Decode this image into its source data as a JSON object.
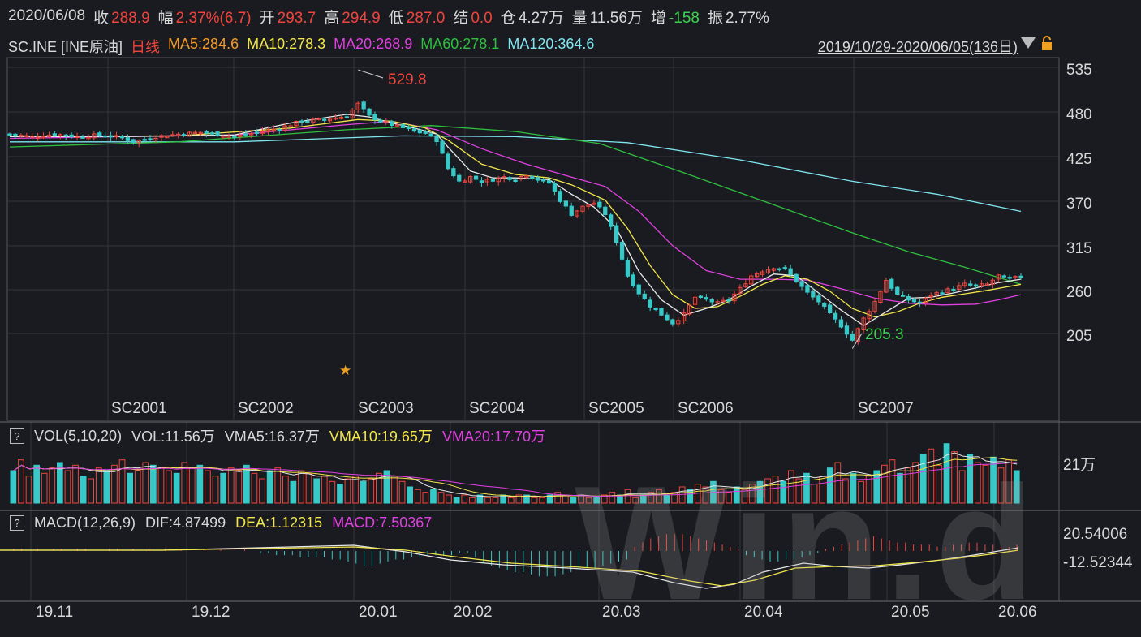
{
  "quote": {
    "date": "2020/06/08",
    "close_label": "收",
    "close": "288.9",
    "change_label": "幅",
    "change": "2.37%(6.7)",
    "open_label": "开",
    "open": "293.7",
    "high_label": "高",
    "high": "294.9",
    "low_label": "低",
    "low": "287.0",
    "settle_label": "结",
    "settle": "0.0",
    "oi_label": "仓",
    "oi": "4.27万",
    "volume_label": "量",
    "volume": "11.56万",
    "oi_change_label": "增",
    "oi_change": "-158",
    "amplitude_label": "振",
    "amplitude": "2.77%"
  },
  "legend": {
    "symbol": "SC.INE [INE原油]",
    "period": "日线",
    "ma5": "MA5:284.6",
    "ma10": "MA10:278.3",
    "ma20": "MA20:268.9",
    "ma60": "MA60:278.1",
    "ma120": "MA120:364.6",
    "range": "2019/10/29-2020/06/05(136日)"
  },
  "colors": {
    "up": "#f0453c",
    "down": "#37c8c8",
    "ma5": "#e8e8e8",
    "ma10": "#f2e64a",
    "ma20": "#e040e0",
    "ma60": "#2fbf3f",
    "ma120": "#7fe6f0"
  },
  "price_axis": {
    "ticks": [
      "535",
      "480",
      "425",
      "370",
      "315",
      "260",
      "205"
    ]
  },
  "annotations": {
    "high": "529.8",
    "low": "205.3"
  },
  "contracts": [
    "SC2001",
    "SC2002",
    "SC2003",
    "SC2004",
    "SC2005",
    "SC2006",
    "SC2007"
  ],
  "volume_panel": {
    "label": "VOL(5,10,20)",
    "vol": "VOL:11.56万",
    "vma5": "VMA5:16.37万",
    "vma10": "VMA10:19.65万",
    "vma20": "VMA20:17.70万",
    "axis": "21万"
  },
  "macd_panel": {
    "label": "MACD(12,26,9)",
    "dif": "DIF:4.87499",
    "dea": "DEA:1.12315",
    "macd": "MACD:7.50367",
    "axis_top": "20.54006",
    "axis_bottom": "-12.52344"
  },
  "date_axis": [
    "19.11",
    "19.12",
    "20.01",
    "20.02",
    "20.03",
    "20.04",
    "20.05",
    "20.06"
  ],
  "watermark": "Win.d",
  "chart_data": {
    "type": "candlestick",
    "ylim": [
      150,
      545
    ],
    "x_range": [
      "2019/10/29",
      "2020/06/05"
    ],
    "close_path": [
      [
        0,
        455
      ],
      [
        4,
        452
      ],
      [
        8,
        455
      ],
      [
        12,
        452
      ],
      [
        16,
        454
      ],
      [
        20,
        451
      ],
      [
        22,
        446
      ],
      [
        26,
        452
      ],
      [
        30,
        455
      ],
      [
        34,
        457
      ],
      [
        38,
        454
      ],
      [
        40,
        452
      ],
      [
        44,
        457
      ],
      [
        48,
        462
      ],
      [
        52,
        470
      ],
      [
        56,
        472
      ],
      [
        60,
        476
      ],
      [
        62,
        490
      ],
      [
        64,
        476
      ],
      [
        66,
        470
      ],
      [
        68,
        466
      ],
      [
        70,
        462
      ],
      [
        72,
        458
      ],
      [
        74,
        456
      ],
      [
        76,
        448
      ],
      [
        78,
        415
      ],
      [
        80,
        400
      ],
      [
        82,
        405
      ],
      [
        84,
        400
      ],
      [
        86,
        402
      ],
      [
        88,
        405
      ],
      [
        90,
        403
      ],
      [
        92,
        408
      ],
      [
        94,
        402
      ],
      [
        96,
        398
      ],
      [
        98,
        378
      ],
      [
        100,
        362
      ],
      [
        102,
        370
      ],
      [
        104,
        375
      ],
      [
        106,
        362
      ],
      [
        108,
        330
      ],
      [
        110,
        290
      ],
      [
        112,
        270
      ],
      [
        114,
        255
      ],
      [
        116,
        245
      ],
      [
        118,
        235
      ],
      [
        120,
        245
      ],
      [
        122,
        265
      ],
      [
        124,
        262
      ],
      [
        126,
        258
      ],
      [
        128,
        262
      ],
      [
        130,
        275
      ],
      [
        132,
        290
      ],
      [
        134,
        296
      ],
      [
        136,
        300
      ],
      [
        138,
        298
      ],
      [
        140,
        284
      ],
      [
        142,
        270
      ],
      [
        144,
        260
      ],
      [
        146,
        245
      ],
      [
        148,
        232
      ],
      [
        150,
        215
      ],
      [
        152,
        240
      ],
      [
        154,
        260
      ],
      [
        156,
        285
      ],
      [
        158,
        268
      ],
      [
        160,
        262
      ],
      [
        162,
        258
      ],
      [
        164,
        268
      ],
      [
        166,
        272
      ],
      [
        168,
        275
      ],
      [
        170,
        280
      ],
      [
        172,
        278
      ],
      [
        174,
        280
      ],
      [
        176,
        290
      ],
      [
        178,
        286
      ],
      [
        180,
        289
      ]
    ],
    "ma5_path": [
      [
        0,
        452
      ],
      [
        20,
        452
      ],
      [
        40,
        454
      ],
      [
        50,
        468
      ],
      [
        60,
        478
      ],
      [
        64,
        475
      ],
      [
        68,
        468
      ],
      [
        72,
        462
      ],
      [
        76,
        455
      ],
      [
        78,
        440
      ],
      [
        82,
        412
      ],
      [
        86,
        404
      ],
      [
        90,
        404
      ],
      [
        96,
        402
      ],
      [
        100,
        385
      ],
      [
        104,
        370
      ],
      [
        108,
        345
      ],
      [
        112,
        295
      ],
      [
        116,
        262
      ],
      [
        120,
        244
      ],
      [
        124,
        252
      ],
      [
        128,
        262
      ],
      [
        132,
        278
      ],
      [
        136,
        292
      ],
      [
        140,
        290
      ],
      [
        144,
        270
      ],
      [
        148,
        250
      ],
      [
        152,
        232
      ],
      [
        156,
        248
      ],
      [
        160,
        264
      ],
      [
        164,
        265
      ],
      [
        168,
        270
      ],
      [
        172,
        276
      ],
      [
        176,
        282
      ],
      [
        180,
        286
      ]
    ],
    "ma10_path": [
      [
        0,
        452
      ],
      [
        30,
        453
      ],
      [
        50,
        462
      ],
      [
        62,
        472
      ],
      [
        68,
        470
      ],
      [
        74,
        462
      ],
      [
        78,
        448
      ],
      [
        84,
        420
      ],
      [
        90,
        408
      ],
      [
        96,
        404
      ],
      [
        100,
        396
      ],
      [
        106,
        378
      ],
      [
        110,
        345
      ],
      [
        114,
        302
      ],
      [
        118,
        268
      ],
      [
        122,
        252
      ],
      [
        126,
        254
      ],
      [
        130,
        266
      ],
      [
        134,
        280
      ],
      [
        138,
        290
      ],
      [
        142,
        286
      ],
      [
        146,
        272
      ],
      [
        150,
        252
      ],
      [
        154,
        242
      ],
      [
        158,
        248
      ],
      [
        162,
        258
      ],
      [
        166,
        265
      ],
      [
        170,
        269
      ],
      [
        174,
        273
      ],
      [
        180,
        280
      ]
    ],
    "ma20_path": [
      [
        0,
        450
      ],
      [
        40,
        454
      ],
      [
        60,
        466
      ],
      [
        68,
        470
      ],
      [
        76,
        460
      ],
      [
        84,
        438
      ],
      [
        92,
        420
      ],
      [
        100,
        405
      ],
      [
        106,
        394
      ],
      [
        112,
        365
      ],
      [
        118,
        325
      ],
      [
        124,
        296
      ],
      [
        130,
        286
      ],
      [
        136,
        286
      ],
      [
        142,
        285
      ],
      [
        148,
        275
      ],
      [
        154,
        264
      ],
      [
        160,
        258
      ],
      [
        166,
        256
      ],
      [
        172,
        257
      ],
      [
        176,
        262
      ],
      [
        180,
        268
      ]
    ],
    "ma60_path": [
      [
        0,
        440
      ],
      [
        30,
        446
      ],
      [
        60,
        460
      ],
      [
        75,
        465
      ],
      [
        90,
        458
      ],
      [
        105,
        444
      ],
      [
        120,
        410
      ],
      [
        135,
        375
      ],
      [
        150,
        340
      ],
      [
        160,
        318
      ],
      [
        170,
        300
      ],
      [
        180,
        280
      ]
    ],
    "ma120_path": [
      [
        0,
        446
      ],
      [
        40,
        446
      ],
      [
        70,
        453
      ],
      [
        90,
        452
      ],
      [
        110,
        445
      ],
      [
        130,
        425
      ],
      [
        150,
        400
      ],
      [
        165,
        385
      ],
      [
        180,
        365
      ]
    ],
    "volume_bars": [
      12,
      16,
      10,
      14,
      11,
      13,
      15,
      12,
      14,
      10,
      9,
      13,
      12,
      14,
      16,
      11,
      12,
      15,
      14,
      13,
      12,
      11,
      15,
      13,
      14,
      12,
      10,
      11,
      13,
      12,
      14,
      11,
      9,
      12,
      13,
      10,
      8,
      12,
      11,
      9,
      10,
      8,
      7,
      9,
      10,
      8,
      9,
      11,
      12,
      10,
      8,
      6,
      5,
      4,
      5,
      4,
      3,
      2,
      3,
      2,
      3,
      2,
      2,
      3,
      2,
      3,
      3,
      2,
      2,
      3,
      4,
      3,
      2,
      3,
      2,
      2,
      3,
      4,
      3,
      5,
      2,
      3,
      4,
      5,
      3,
      4,
      6,
      5,
      7,
      6,
      8,
      5,
      4,
      6,
      5,
      7,
      8,
      9,
      10,
      8,
      12,
      9,
      11,
      7,
      10,
      13,
      15,
      9,
      11,
      8,
      10,
      12,
      14,
      16,
      11,
      13,
      15,
      18,
      20,
      14,
      22,
      19,
      12,
      18,
      15,
      14,
      17,
      13,
      16,
      12
    ],
    "macd_bars": [
      1,
      1,
      0,
      1,
      0,
      1,
      1,
      0,
      1,
      1,
      0,
      0,
      1,
      1,
      0,
      1,
      0,
      1,
      0,
      1,
      0,
      1,
      0,
      0,
      1,
      0,
      1,
      0,
      0,
      1,
      0,
      -1,
      -1,
      -2,
      -2,
      -2,
      -3,
      -3,
      -3,
      -3,
      -4,
      -4,
      -5,
      -6,
      -7,
      -7,
      -6,
      -5,
      -4,
      -4,
      -3,
      -3,
      -2,
      -2,
      -2,
      -2,
      -1,
      -1,
      -3,
      -5,
      -7,
      -8,
      -9,
      -10,
      -10,
      -11,
      -12,
      -12,
      -12,
      -11,
      -10,
      -9,
      -8,
      -8,
      -7,
      -6,
      -5,
      -4,
      2,
      4,
      6,
      7,
      8,
      8,
      8,
      7,
      6,
      5,
      4,
      3,
      2,
      1,
      -2,
      -3,
      -4,
      -5,
      -5,
      -4,
      -4,
      -3,
      -2,
      -1,
      1,
      2,
      3,
      4,
      5,
      6,
      7,
      6,
      5,
      4,
      4,
      3,
      3,
      3,
      2,
      2,
      3,
      3,
      4,
      4,
      3,
      3,
      2,
      2,
      3
    ]
  }
}
